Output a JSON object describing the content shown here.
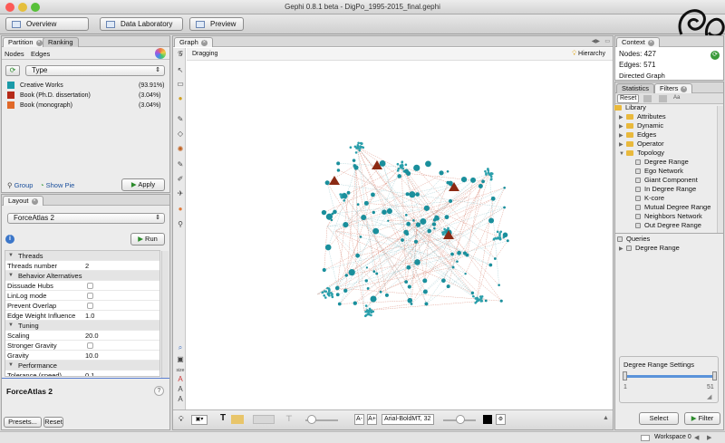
{
  "window": {
    "title": "Gephi 0.8.1 beta - DigPo_1995-2015_final.gephi"
  },
  "toolbar": {
    "overview": "Overview",
    "data_lab": "Data Laboratory",
    "preview": "Preview"
  },
  "partition": {
    "tabs": [
      "Partition",
      "Ranking"
    ],
    "subtabs": [
      "Nodes",
      "Edges"
    ],
    "type_value": "Type",
    "items": [
      {
        "label": "Creative Works",
        "pct": "(93.91%)",
        "color": "#1a9aa8"
      },
      {
        "label": "Book (Ph.D. dissertation)",
        "pct": "(3.04%)",
        "color": "#b52a18"
      },
      {
        "label": "Book (monograph)",
        "pct": "(3.04%)",
        "color": "#e0692a"
      }
    ],
    "group": "Group",
    "show_pie": "Show Pie",
    "apply": "Apply"
  },
  "layout": {
    "tab": "Layout",
    "algorithm": "ForceAtlas 2",
    "run": "Run",
    "props": [
      {
        "type": "cat",
        "key": "Threads"
      },
      {
        "type": "val",
        "key": "Threads number",
        "val": "2"
      },
      {
        "type": "cat",
        "key": "Behavior Alternatives"
      },
      {
        "type": "chk",
        "key": "Dissuade Hubs"
      },
      {
        "type": "chk",
        "key": "LinLog mode"
      },
      {
        "type": "chk",
        "key": "Prevent Overlap"
      },
      {
        "type": "val",
        "key": "Edge Weight Influence",
        "val": "1.0"
      },
      {
        "type": "cat",
        "key": "Tuning"
      },
      {
        "type": "val",
        "key": "Scaling",
        "val": "20.0"
      },
      {
        "type": "chk",
        "key": "Stronger Gravity"
      },
      {
        "type": "val",
        "key": "Gravity",
        "val": "10.0"
      },
      {
        "type": "cat",
        "key": "Performance"
      },
      {
        "type": "val",
        "key": "Tolerance (speed)",
        "val": "0.1"
      }
    ],
    "desc_title": "ForceAtlas 2",
    "presets": "Presets...",
    "reset": "Reset"
  },
  "graph": {
    "tab": "Graph",
    "mode": "Dragging",
    "hierarchy": "Hierarchy",
    "font": "Arial-BoldMT, 32",
    "size_label": "size"
  },
  "context": {
    "tab": "Context",
    "nodes_label": "Nodes:",
    "nodes": "427",
    "edges_label": "Edges:",
    "edges": "571",
    "type": "Directed Graph"
  },
  "filters": {
    "tabs": [
      "Statistics",
      "Filters"
    ],
    "reset": "Reset",
    "library": "Library",
    "folders": [
      "Attributes",
      "Dynamic",
      "Edges",
      "Operator",
      "Topology"
    ],
    "topology": [
      "Degree Range",
      "Ego Network",
      "Giant Component",
      "In Degree Range",
      "K-core",
      "Mutual Degree Range",
      "Neighbors Network",
      "Out Degree Range"
    ],
    "queries": "Queries",
    "query_item": "Degree Range",
    "settings_title": "Degree Range Settings",
    "range_min": "1",
    "range_max": "51",
    "select": "Select",
    "filter": "Filter"
  },
  "status": {
    "workspace": "Workspace 0"
  }
}
